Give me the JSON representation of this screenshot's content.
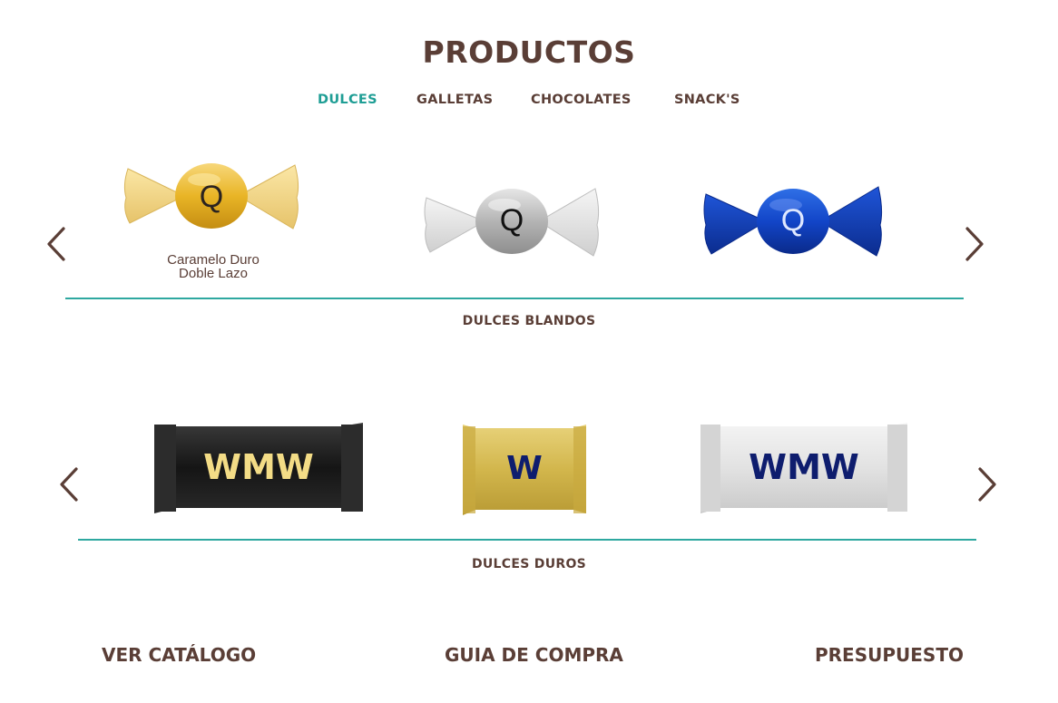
{
  "page_title": "PRODUCTOS",
  "tabs": [
    {
      "label": "DULCES",
      "active": true
    },
    {
      "label": "GALLETAS",
      "active": false
    },
    {
      "label": "CHOCOLATES",
      "active": false
    },
    {
      "label": "SNACK'S",
      "active": false
    }
  ],
  "carousel_1": {
    "items": [
      {
        "wrapper_color": "gold",
        "logo": "Q",
        "caption_line1": "Caramelo Duro",
        "caption_line2": "Doble Lazo"
      },
      {
        "wrapper_color": "silver",
        "logo": "Q"
      },
      {
        "wrapper_color": "blue",
        "logo": "Q"
      }
    ],
    "section_label": "DULCES BLANDOS"
  },
  "carousel_2": {
    "items": [
      {
        "wrapper_color": "black",
        "logo": "WMW"
      },
      {
        "wrapper_color": "gold",
        "logo": "W"
      },
      {
        "wrapper_color": "silver",
        "logo": "WMW"
      }
    ],
    "section_label": "DULCES DUROS"
  },
  "bottom_links": {
    "catalog": "VER CATÁLOGO",
    "guide": "GUIA DE COMPRA",
    "quote": "PRESUPUESTO"
  },
  "colors": {
    "brand_brown": "#5a3e36",
    "accent_teal": "#1f9e95",
    "divider_teal": "#2ea8a0"
  },
  "icons": {
    "prev": "chevron-left-icon",
    "next": "chevron-right-icon"
  }
}
